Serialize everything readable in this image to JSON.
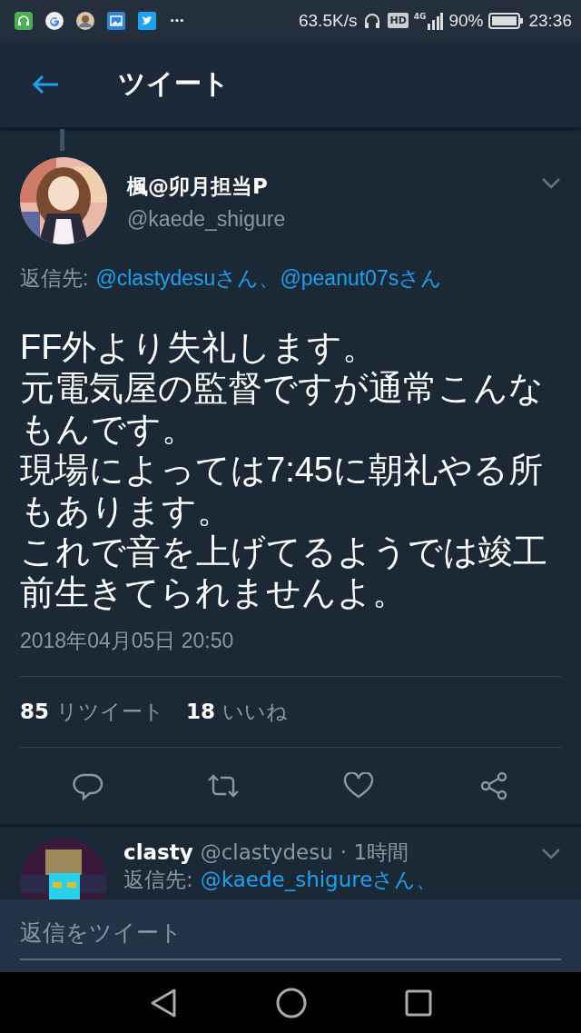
{
  "status_bar": {
    "speed": "63.5K/s",
    "hd_badge": "HD",
    "network": "4G",
    "battery": "90%",
    "time": "23:36"
  },
  "header": {
    "title": "ツイート"
  },
  "tweet": {
    "display_name": "楓@卯月担当P",
    "handle": "@kaede_shigure",
    "reply_to_label": "返信先:",
    "reply_to": [
      "@clastydesuさん",
      "@peanut07sさん"
    ],
    "reply_separator": "、",
    "body": [
      "FF外より失礼します。",
      "元電気屋の監督ですが通常こんなもんです。",
      "現場によっては7:45に朝礼やる所もあります。",
      "これで音を上げてるようでは竣工前生きてられませんよ。"
    ],
    "timestamp": "2018年04月05日 20:50",
    "stats": [
      {
        "count": "85",
        "label": "リツイート"
      },
      {
        "count": "18",
        "label": "いいね"
      }
    ]
  },
  "reply": {
    "display_name": "clasty",
    "handle": "@clastydesu",
    "age": "· 1時間",
    "reply_to_label": "返信先:",
    "reply_to": "@kaede_shigureさん、"
  },
  "composer": {
    "placeholder": "返信をツイート"
  }
}
